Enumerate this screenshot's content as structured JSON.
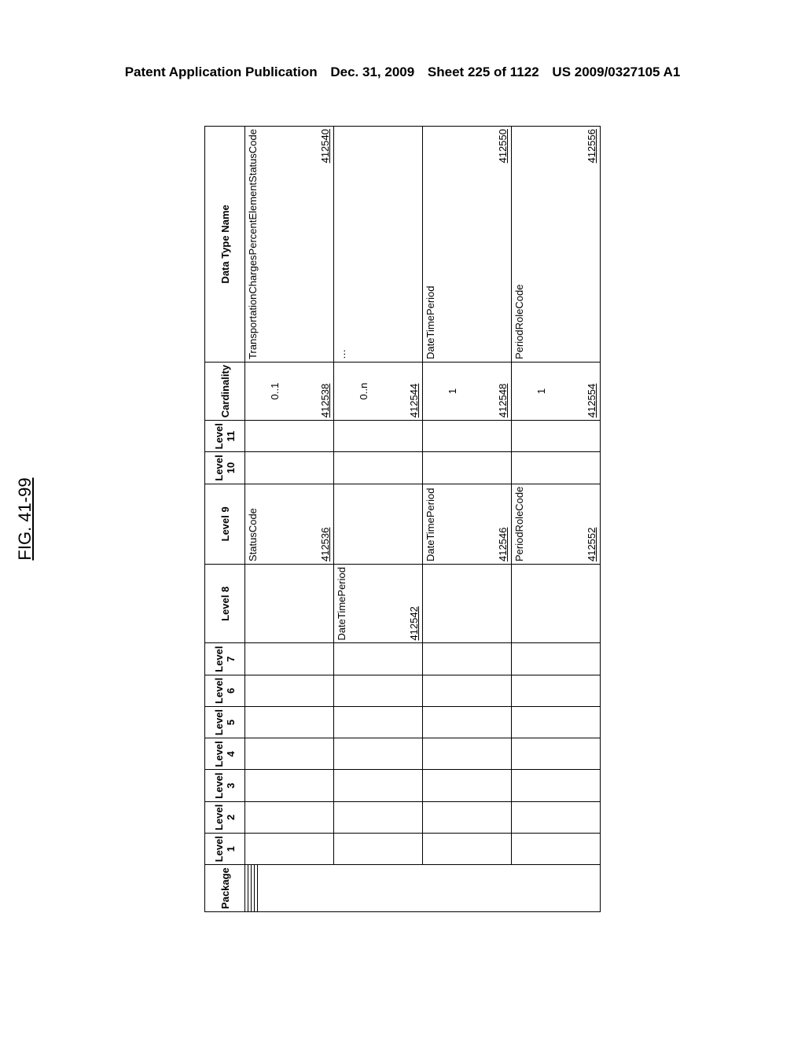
{
  "header": {
    "pub": "Patent Application Publication",
    "date": "Dec. 31, 2009",
    "sheet": "Sheet 225 of 1122",
    "docnum": "US 2009/0327105 A1"
  },
  "figure_label": "FIG. 41-99",
  "columns": {
    "package": "Package",
    "l1": "Level 1",
    "l2": "Level 2",
    "l3": "Level 3",
    "l4": "Level 4",
    "l5": "Level 5",
    "l6": "Level 6",
    "l7": "Level 7",
    "l8": "Level 8",
    "l9": "Level 9",
    "l10": "Level 10",
    "l11": "Level 11",
    "card": "Cardinality",
    "dtype": "Data Type Name"
  },
  "rows": [
    {
      "l9": "StatusCode",
      "l9_ref": "412536",
      "card": "0..1",
      "card_ref": "412538",
      "dtype": "TransportationChargesPercentElementStatusCode",
      "dtype_ref": "412540"
    },
    {
      "l8": "DateTimePeriod",
      "l8_ref": "412542",
      "card": "0..n",
      "card_ref": "412544",
      "dtype": "…"
    },
    {
      "l9": "DateTimePeriod",
      "l9_ref": "412546",
      "card": "1",
      "card_ref": "412548",
      "dtype": "DateTimePeriod",
      "dtype_ref": "412550"
    },
    {
      "l9": "PeriodRoleCode",
      "l9_ref": "412552",
      "card": "1",
      "card_ref": "412554",
      "dtype": "PeriodRoleCode",
      "dtype_ref": "412556"
    }
  ]
}
